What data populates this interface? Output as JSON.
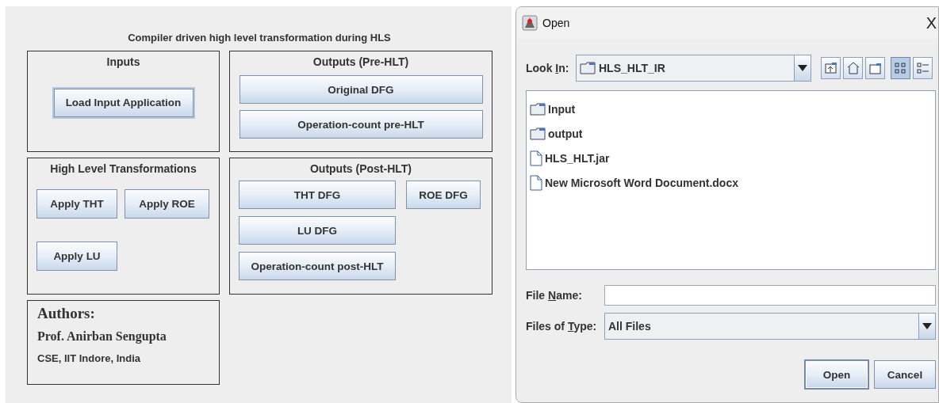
{
  "main": {
    "title": "Compiler driven high level transformation during HLS",
    "inputs": {
      "heading": "Inputs",
      "buttons": [
        "Load Input Application"
      ]
    },
    "pre_hlt": {
      "heading": "Outputs (Pre-HLT)",
      "buttons": [
        "Original DFG",
        "Operation-count pre-HLT"
      ]
    },
    "transformations": {
      "heading": "High Level Transformations",
      "buttons": [
        "Apply THT",
        "Apply ROE",
        "Apply LU"
      ]
    },
    "post_hlt": {
      "heading": "Outputs (Post-HLT)",
      "buttons": [
        "THT DFG",
        "ROE DFG",
        "LU DFG",
        "Operation-count post-HLT"
      ]
    },
    "authors": {
      "heading": "Authors:",
      "name": "Prof. Anirban Sengupta",
      "affiliation": "CSE, IIT Indore, India"
    }
  },
  "dialog": {
    "title": "Open",
    "close": "X",
    "look_in": {
      "label": [
        "Look ",
        "I",
        "n:"
      ],
      "value": "HLS_HLT_IR"
    },
    "tools": [
      {
        "kind": "up"
      },
      {
        "kind": "home"
      },
      {
        "kind": "new"
      }
    ],
    "views": [
      {
        "kind": "list",
        "selected": true
      },
      {
        "kind": "details",
        "selected": false
      }
    ],
    "files": [
      {
        "kind": "folder",
        "name": "Input"
      },
      {
        "kind": "folder",
        "name": "output"
      },
      {
        "kind": "file",
        "name": "HLS_HLT.jar"
      },
      {
        "kind": "file",
        "name": "New Microsoft Word Document.docx"
      }
    ],
    "file_name": {
      "label": [
        "File ",
        "N",
        "ame:"
      ]
    },
    "file_type": {
      "label": [
        "Files of ",
        "T",
        "ype:"
      ],
      "value": "All Files"
    },
    "buttons": [
      {
        "label": "Open",
        "default": true
      },
      {
        "label": "Cancel",
        "default": false
      }
    ]
  }
}
